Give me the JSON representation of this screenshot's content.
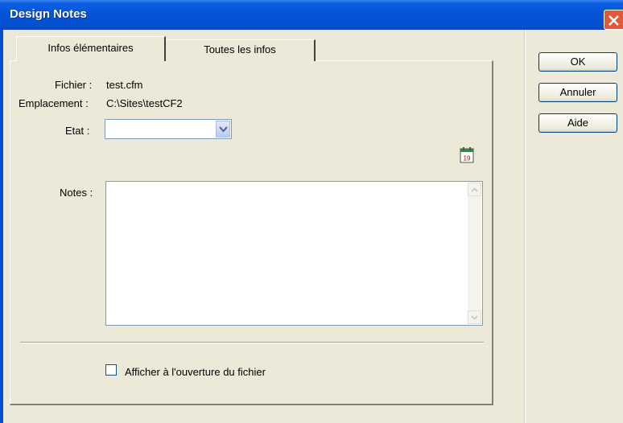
{
  "window": {
    "title": "Design Notes"
  },
  "tabs": [
    {
      "label": "Infos élémentaires",
      "active": true
    },
    {
      "label": "Toutes les infos",
      "active": false
    }
  ],
  "fields": {
    "file_label": "Fichier :",
    "file_value": "test.cfm",
    "location_label": "Emplacement :",
    "location_value": "C:\\Sites\\testCF2",
    "status_label": "Etat :",
    "status_value": "",
    "notes_label": "Notes :",
    "notes_value": ""
  },
  "checkbox": {
    "label": "Afficher à l'ouverture du fichier",
    "checked": false
  },
  "buttons": {
    "ok": "OK",
    "cancel": "Annuler",
    "help": "Aide"
  },
  "calendar_icon": {
    "day": "19"
  },
  "colors": {
    "titlebar": "#0554d8",
    "close": "#e4573a",
    "dialog_bg": "#ece9d8"
  }
}
